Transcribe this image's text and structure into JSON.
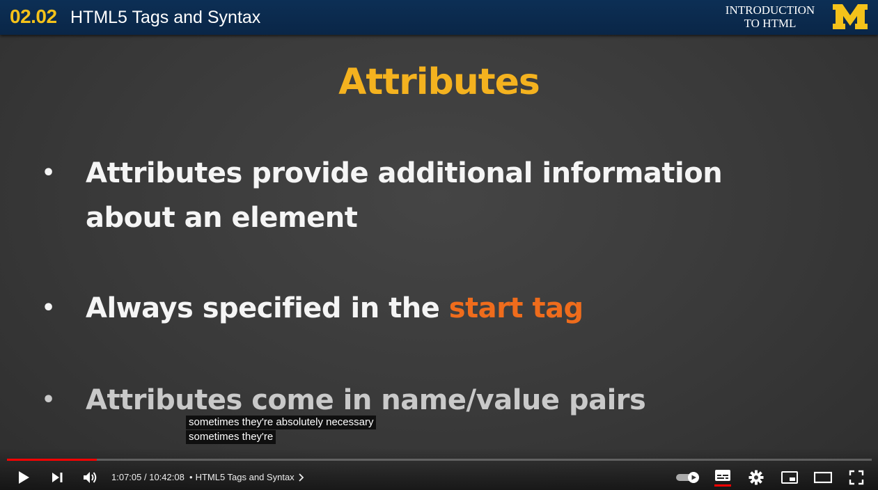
{
  "header": {
    "lesson_number": "02.02",
    "lesson_title": "HTML5 Tags and Syntax",
    "course_line1": "INTRODUCTION",
    "course_line2": "TO HTML",
    "logo_letter": "M"
  },
  "slide": {
    "title": "Attributes",
    "bullets": [
      {
        "text": "Attributes provide additional information about an element"
      },
      {
        "text_before": "Always specified in the ",
        "text_accent": "start tag"
      },
      {
        "text": "Attributes come in name/value pairs"
      }
    ]
  },
  "captions": {
    "line1": "sometimes they're absolutely necessary",
    "line2": "sometimes they're"
  },
  "player": {
    "current_time": "1:07:05",
    "duration": "10:42:08",
    "time_separator": " / ",
    "chapter_bullet": "•",
    "chapter_title": "HTML5 Tags and Syntax",
    "progress_fraction": 0.104,
    "colors": {
      "progress": "#ff0000",
      "subtitle_underline": "#ff0000"
    },
    "icons": [
      "play-icon",
      "next-icon",
      "volume-icon",
      "chevron-right-icon",
      "autoplay-toggle-icon",
      "subtitles-icon",
      "settings-icon",
      "miniplayer-icon",
      "theater-icon",
      "fullscreen-icon"
    ]
  }
}
